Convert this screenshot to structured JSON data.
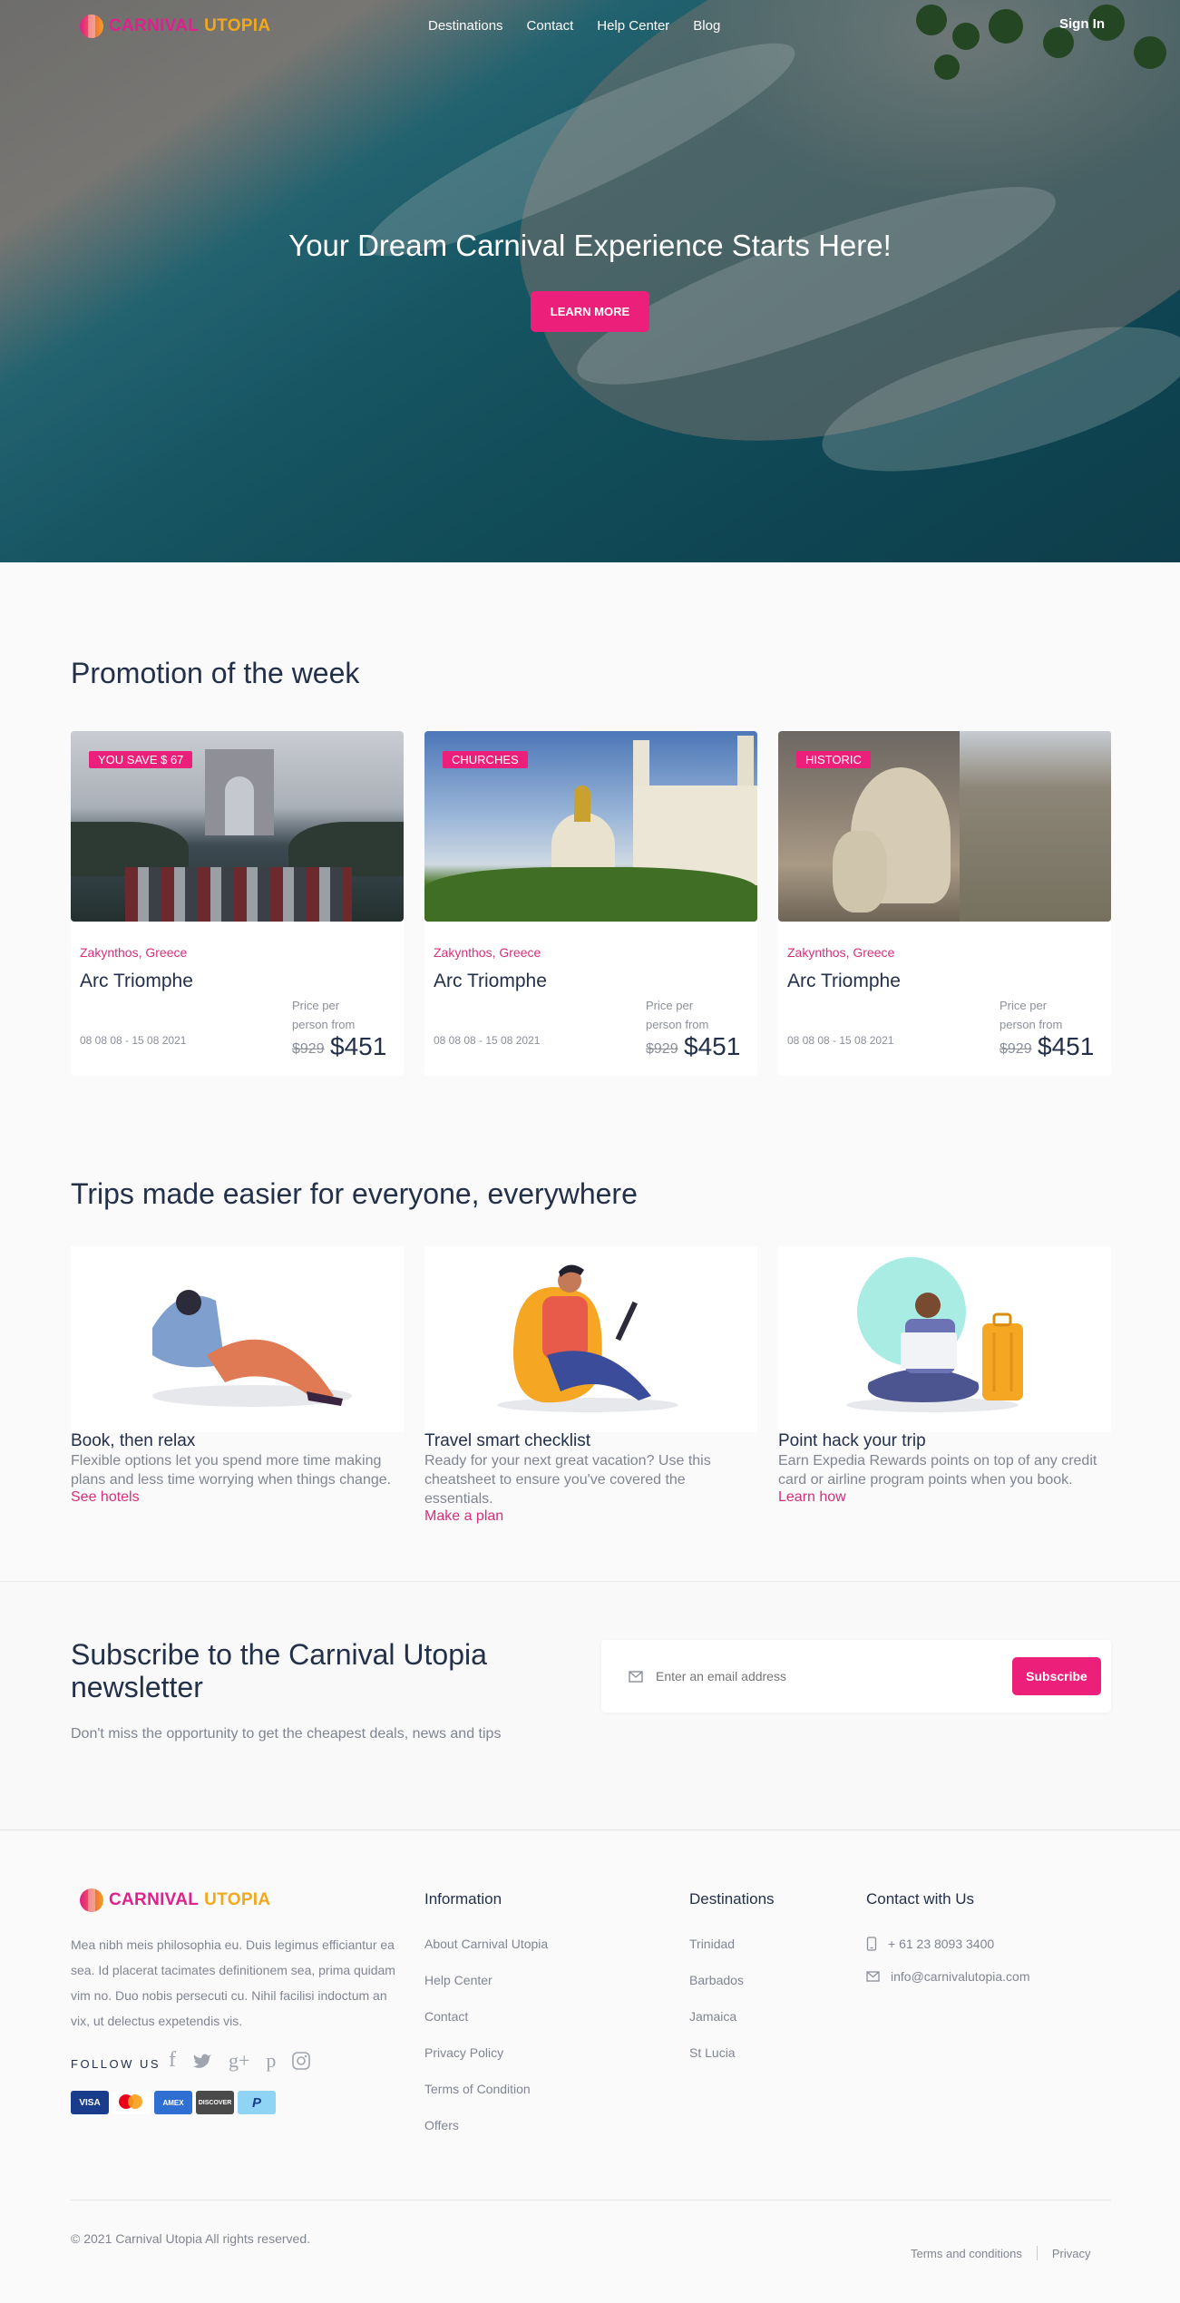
{
  "brand": {
    "part1": "CARNIVAL",
    "part2": "UTOPIA"
  },
  "nav": {
    "items": [
      "Destinations",
      "Contact",
      "Help Center",
      "Blog"
    ],
    "sign_in": "Sign In"
  },
  "hero": {
    "title": "Your Dream Carnival Experience Starts Here!",
    "cta": "LEARN MORE"
  },
  "promotion": {
    "title": "Promotion of the week",
    "cards": [
      {
        "tag": "YOU SAVE $ 67",
        "location": "Zakynthos, Greece",
        "name": "Arc Triomphe",
        "dates": "08 08 08 - 15 08 2021",
        "price_label": "Price per person from",
        "old_price": "$929",
        "price": "$451"
      },
      {
        "tag": "CHURCHES",
        "location": "Zakynthos, Greece",
        "name": "Arc Triomphe",
        "dates": "08 08 08 - 15 08 2021",
        "price_label": "Price per person from",
        "old_price": "$929",
        "price": "$451"
      },
      {
        "tag": "HISTORIC",
        "location": "Zakynthos, Greece",
        "name": "Arc Triomphe",
        "dates": "08 08 08 - 15 08 2021",
        "price_label": "Price per person from",
        "old_price": "$929",
        "price": "$451"
      }
    ]
  },
  "trips": {
    "title": "Trips made easier for everyone, everywhere",
    "items": [
      {
        "title": "Book, then relax",
        "desc": "Flexible options let you spend more time making plans and less time worrying when things change.",
        "link": "See hotels"
      },
      {
        "title": "Travel smart checklist",
        "desc": "Ready for your next great vacation? Use this cheatsheet to ensure you've covered the essentials.",
        "link": "Make a plan"
      },
      {
        "title": "Point hack your trip",
        "desc": "Earn Expedia Rewards points on top of any credit card or airline program points when you book.",
        "link": "Learn how"
      }
    ]
  },
  "newsletter": {
    "title": "Subscribe to the Carnival Utopia newsletter",
    "subtitle": "Don't miss the opportunity to get the cheapest deals, news and tips",
    "placeholder": "Enter an email address",
    "button": "Subscribe"
  },
  "footer": {
    "about": "Mea nibh meis philosophia eu. Duis legimus efficiantur ea sea. Id placerat tacimates definitionem sea, prima quidam vim no. Duo nobis persecuti cu. Nihil facilisi indoctum an vix, ut delectus expetendis vis.",
    "follow_label": "FOLLOW US",
    "payments": [
      "VISA",
      "MC",
      "AMEX",
      "DISCOVER",
      "P"
    ],
    "information": {
      "title": "Information",
      "links": [
        "About Carnival Utopia",
        "Help Center",
        "Contact",
        "Privacy Policy",
        "Terms of Condition",
        "Offers"
      ]
    },
    "destinations": {
      "title": "Destinations",
      "links": [
        "Trinidad",
        "Barbados",
        "Jamaica",
        "St Lucia"
      ]
    },
    "contact": {
      "title": "Contact with Us",
      "phone": "+ 61 23 8093 3400",
      "email": "info@carnivalutopia.com"
    },
    "copyright": "© 2021 Carnival Utopia All rights reserved.",
    "terms": "Terms and conditions",
    "privacy": "Privacy"
  },
  "colors": {
    "accent": "#ec1f7a",
    "heading": "#23304a",
    "muted": "#808592"
  }
}
